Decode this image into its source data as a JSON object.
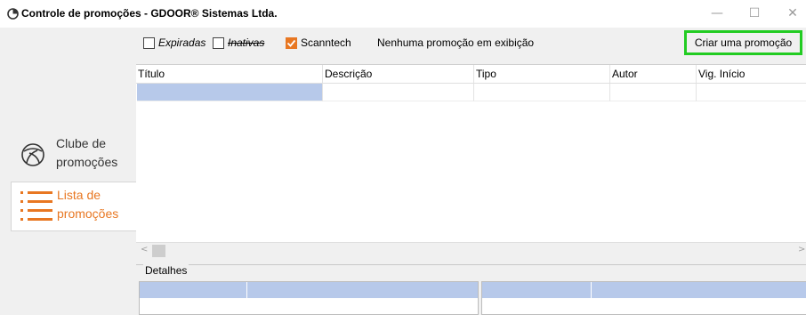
{
  "window": {
    "title": "Controle de promoções - GDOOR® Sistemas Ltda.",
    "minimize_glyph": "—",
    "maximize_glyph": "☐",
    "close_glyph": "✕"
  },
  "sidebar": {
    "items": [
      {
        "label_line1": "Clube de",
        "label_line2": "promoções",
        "icon": "club-icon",
        "active": false
      },
      {
        "label_line1": "Lista de",
        "label_line2": "promoções",
        "icon": "list-icon",
        "active": true
      }
    ]
  },
  "toolbar": {
    "filters": [
      {
        "label": "Expiradas",
        "checked": false
      },
      {
        "label": "Inativas",
        "checked": false
      },
      {
        "label": "Scanntech",
        "checked": true
      }
    ],
    "status_text": "Nenhuma promoção em exibição",
    "create_button_label": "Criar uma promoção"
  },
  "grid": {
    "columns": [
      "Título",
      "Descrição",
      "Tipo",
      "Autor",
      "Vig. Início"
    ]
  },
  "details": {
    "legend": "Detalhes"
  },
  "colors": {
    "accent": "#e87722",
    "selection": "#b7c9ea",
    "highlight_border": "#22cc22"
  }
}
